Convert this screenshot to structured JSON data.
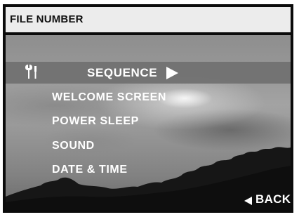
{
  "header": {
    "title": "FILE NUMBER"
  },
  "menu": {
    "icon": "wrench-screwdriver-icon",
    "selected": {
      "label": "SEQUENCE"
    },
    "items": [
      {
        "label": "WELCOME SCREEN"
      },
      {
        "label": "POWER SLEEP"
      },
      {
        "label": "SOUND"
      },
      {
        "label": "DATE & TIME"
      }
    ]
  },
  "footer": {
    "back_label": "BACK"
  },
  "colors": {
    "highlight": "#707070",
    "title_bar": "#ececec",
    "text": "#ffffff"
  }
}
